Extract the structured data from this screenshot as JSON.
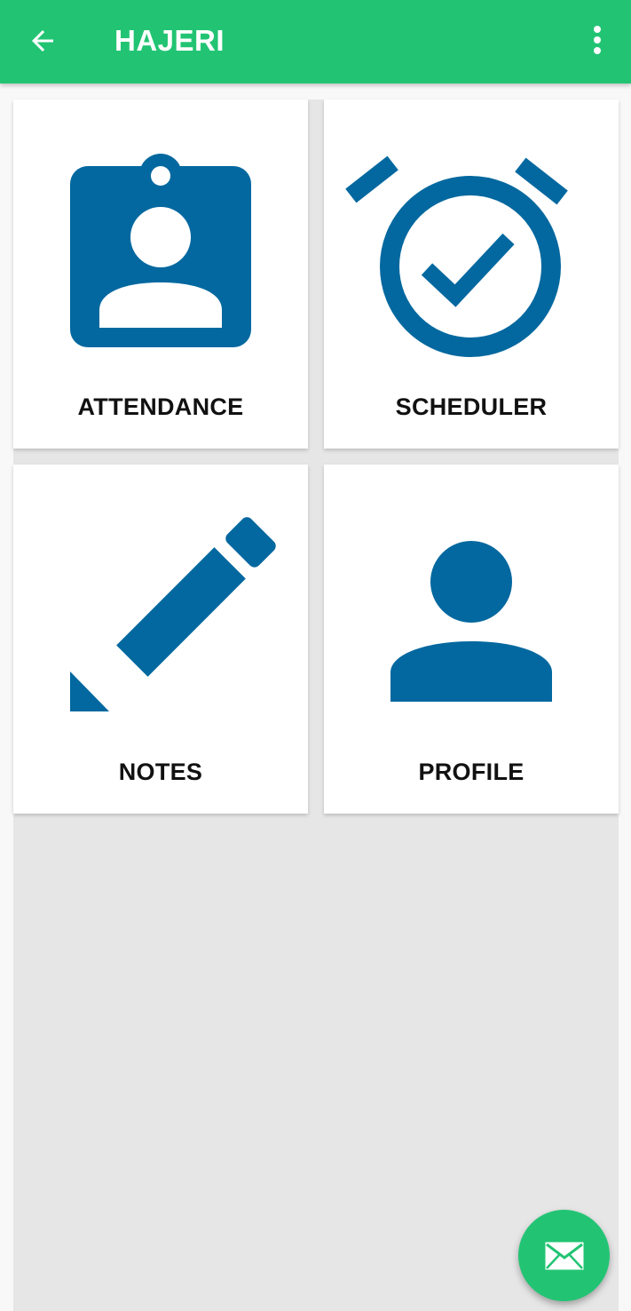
{
  "app_bar": {
    "title": "HAJERI",
    "back_icon": "arrow-left-icon",
    "menu_icon": "more-vertical-icon",
    "background": "#22c473"
  },
  "tiles": [
    {
      "label": "ATTENDANCE",
      "icon": "badge-icon"
    },
    {
      "label": "SCHEDULER",
      "icon": "alarm-check-icon"
    },
    {
      "label": "NOTES",
      "icon": "pencil-icon"
    },
    {
      "label": "PROFILE",
      "icon": "person-icon"
    }
  ],
  "fab": {
    "icon": "mail-icon"
  },
  "colors": {
    "accent": "#22c473",
    "icon": "#03689f",
    "tile_background": "#ffffff",
    "page_background": "#e6e6e6"
  }
}
